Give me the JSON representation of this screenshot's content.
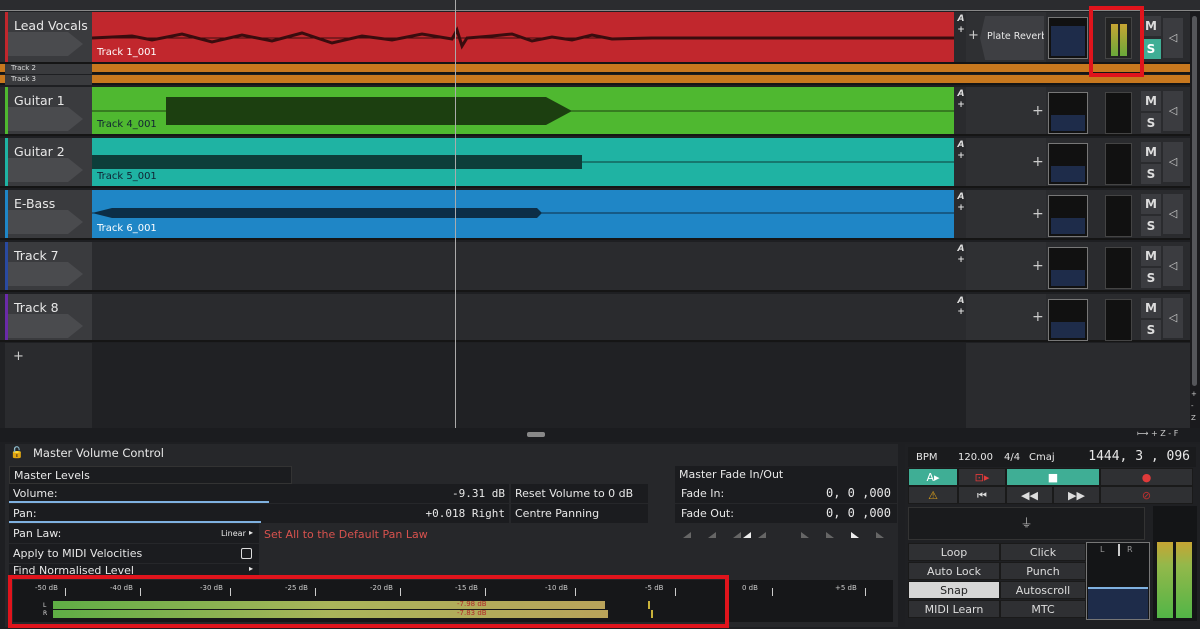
{
  "tracks": [
    {
      "name": "Lead Vocals",
      "clip": "Track 1_001",
      "color": "#c1272d",
      "plugin": "Plate Reverb"
    },
    {
      "name": "Track 2"
    },
    {
      "name": "Track 3"
    },
    {
      "name": "Guitar 1",
      "clip": "Track 4_001",
      "color": "#4fb830"
    },
    {
      "name": "Guitar 2",
      "clip": "Track 5_001",
      "color": "#1fb3a3"
    },
    {
      "name": "E-Bass",
      "clip": "Track 6_001",
      "color": "#1f86c6"
    },
    {
      "name": "Track 7"
    },
    {
      "name": "Track 8"
    }
  ],
  "track_buttons": {
    "mute": "M",
    "solo": "S",
    "ab_a": "A",
    "ab_plus": "+",
    "add": "+"
  },
  "side_tools": {
    "plus": "+",
    "minus": "-",
    "z": "Z"
  },
  "zoom_bar": {
    "z": "Z",
    "minus": "-",
    "plus": "+",
    "f": "F"
  },
  "master": {
    "title": "Master Volume Control",
    "levels_header": "Master Levels",
    "volume_label": "Volume:",
    "volume_value": "-9.31 dB",
    "volume_level_fraction": 0.52,
    "pan_label": "Pan:",
    "pan_value": "+0.018 Right",
    "reset_volume": "Reset Volume to 0 dB",
    "centre_panning": "Centre Panning",
    "pan_law_label": "Pan Law:",
    "pan_law_value": "Linear",
    "set_pan_law": "Set All to the Default Pan Law",
    "apply_midi": "Apply to MIDI Velocities",
    "find_normalised": "Find Normalised Level",
    "fade_header": "Master Fade In/Out",
    "fade_in_label": "Fade In:",
    "fade_in_value": "0, 0 ,000",
    "fade_out_label": "Fade Out:",
    "fade_out_value": "0, 0 ,000"
  },
  "meter": {
    "ticks": [
      "-50 dB",
      "-40 dB",
      "-30 dB",
      "-25 dB",
      "-20 dB",
      "-15 dB",
      "-10 dB",
      "-5 dB",
      "0 dB",
      "+5 dB"
    ],
    "left_label": "L",
    "right_label": "R",
    "left_value": "-7.98 dB",
    "right_value": "-7.83 dB"
  },
  "transport": {
    "bpm_label": "BPM",
    "bpm": "120.00",
    "time_sig": "4/4",
    "key": "Cmaj",
    "position": "1444, 3 , 096",
    "buttons": [
      "Loop",
      "Click",
      "Auto Lock",
      "Punch",
      "Snap",
      "Autoscroll",
      "MIDI Learn",
      "MTC"
    ],
    "l_label": "L",
    "r_label": "R",
    "glyphs": {
      "play_a": "A▸",
      "rec": "⊡▸",
      "stop": "■",
      "record": "●",
      "warn": "⚠",
      "start": "⏮",
      "rew": "◀◀",
      "ff": "▶▶",
      "rec_off": "⊘",
      "plug": "⏚"
    }
  },
  "colors": {
    "accent": "#3fae95",
    "highlight": "#e0141c"
  }
}
